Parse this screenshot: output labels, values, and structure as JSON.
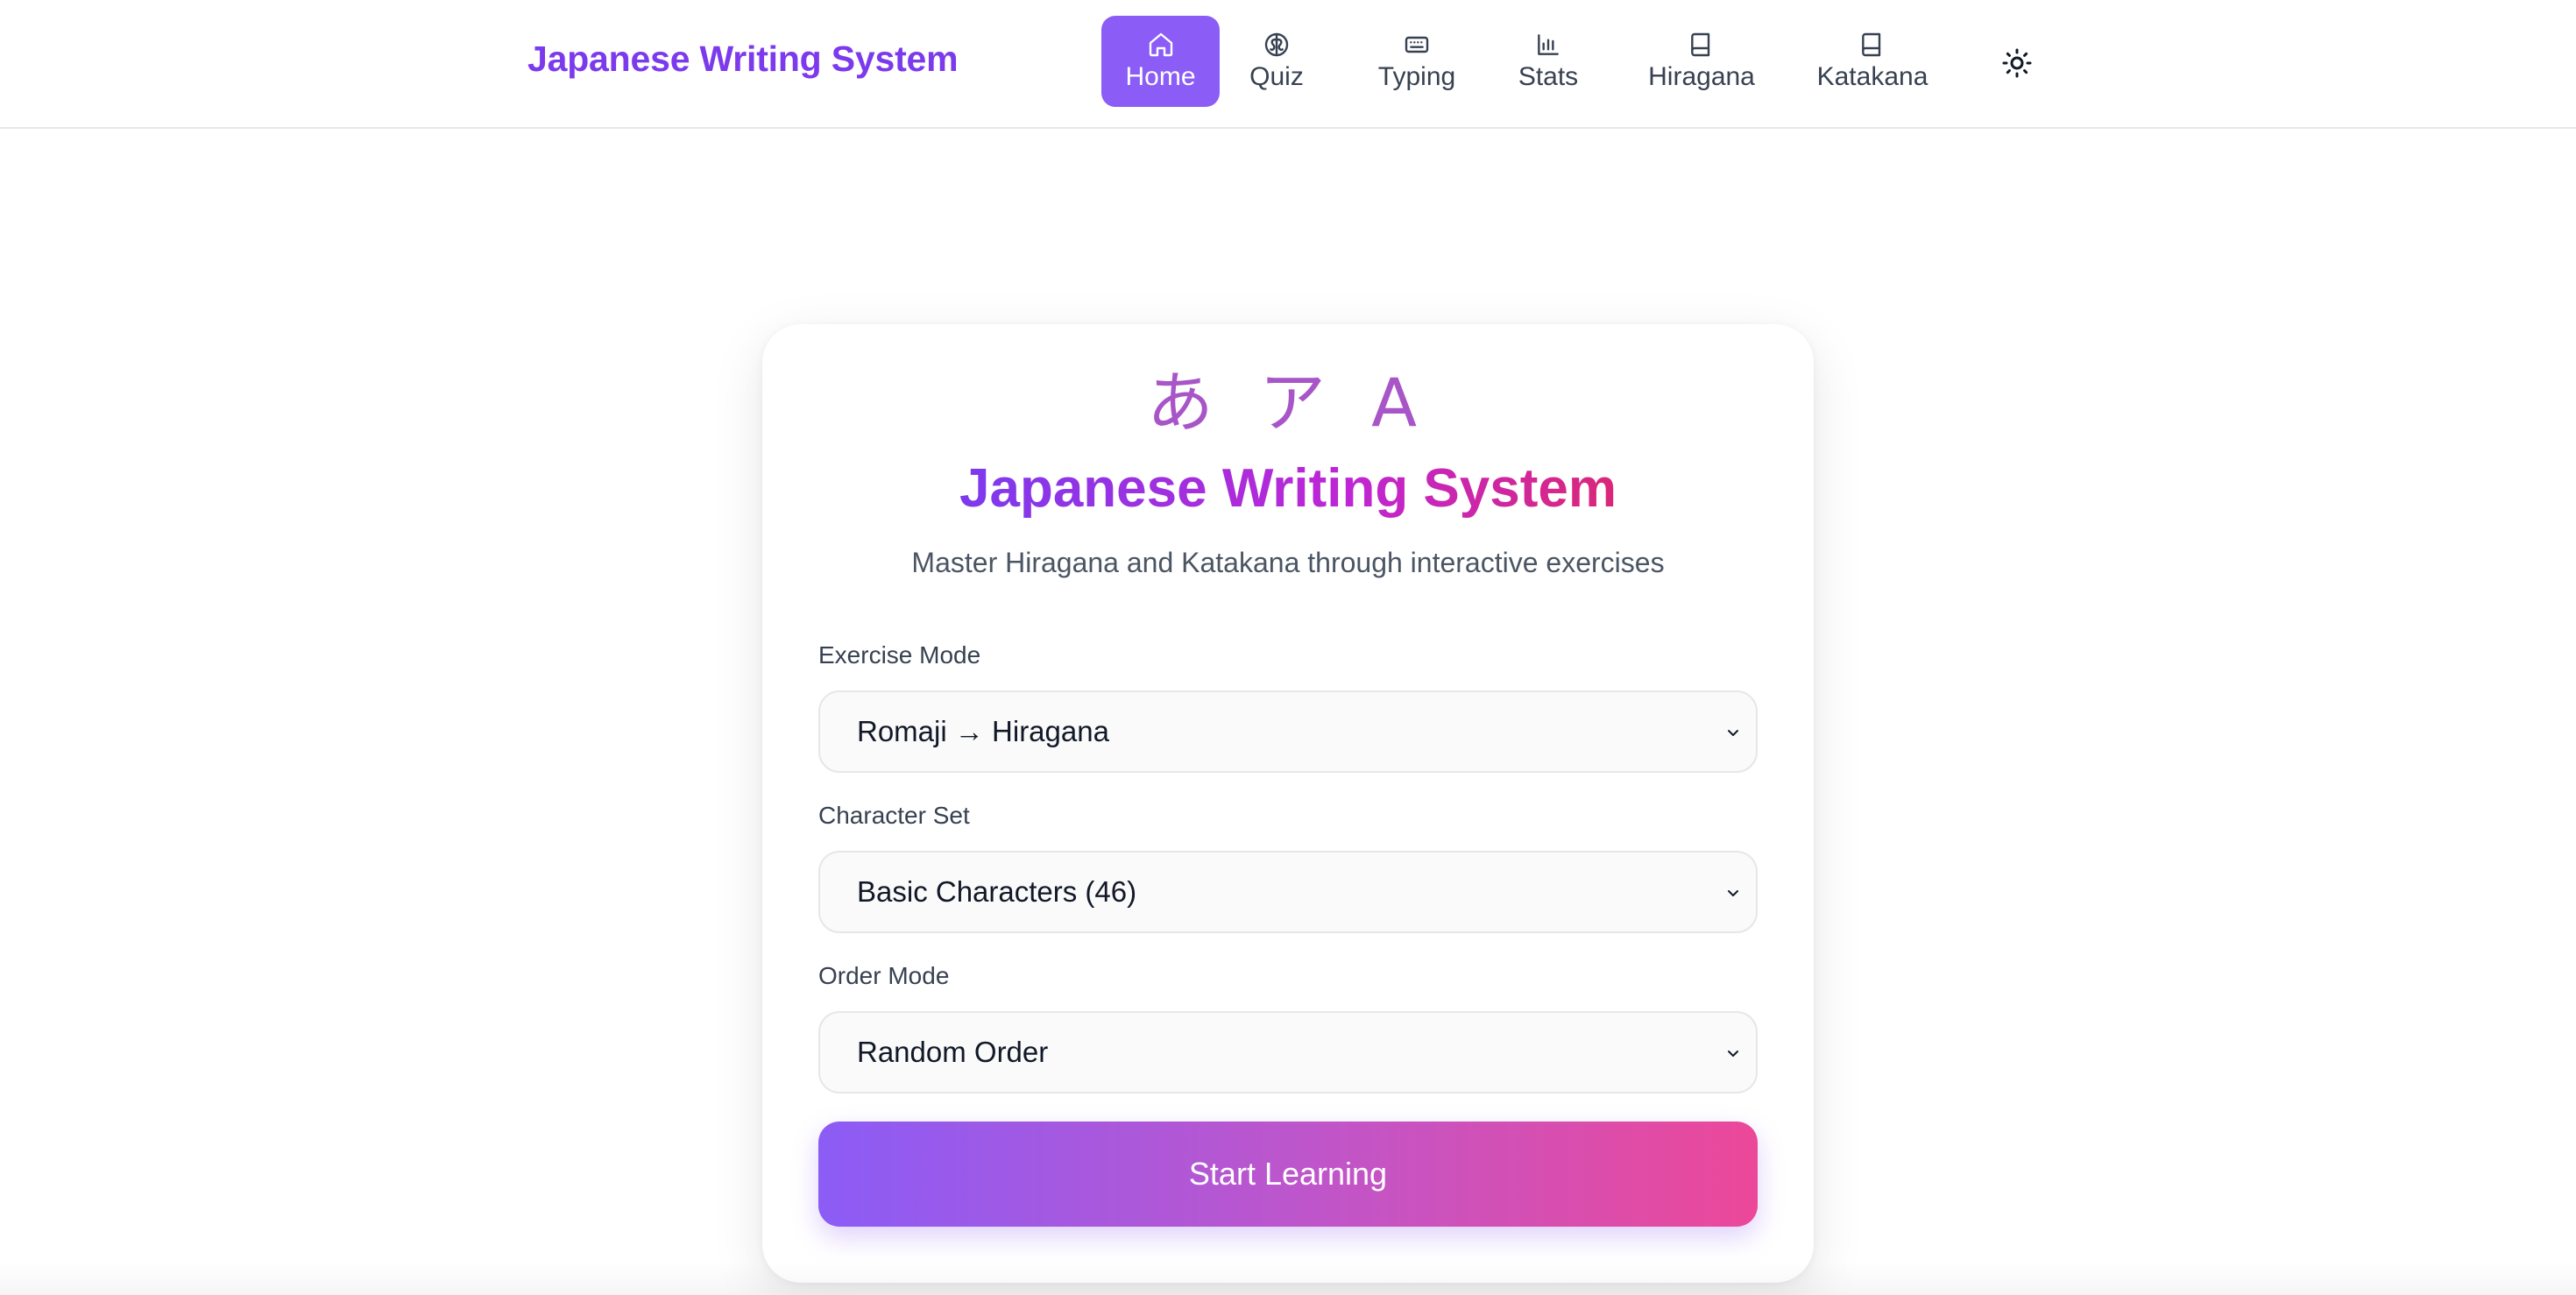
{
  "header": {
    "brand": "Japanese Writing System",
    "nav": [
      {
        "label": "Home",
        "icon": "home-icon",
        "active": true
      },
      {
        "label": "Quiz",
        "icon": "brain-icon",
        "active": false
      },
      {
        "label": "Typing",
        "icon": "keyboard-icon",
        "active": false
      },
      {
        "label": "Stats",
        "icon": "bar-chart-icon",
        "active": false
      },
      {
        "label": "Hiragana",
        "icon": "book-icon",
        "active": false
      },
      {
        "label": "Katakana",
        "icon": "book-icon",
        "active": false
      }
    ],
    "theme_toggle_icon": "sun-icon"
  },
  "card": {
    "glyphs": "あ ア A",
    "title": "Japanese Writing System",
    "subtitle": "Master Hiragana and Katakana through interactive exercises",
    "fields": [
      {
        "label": "Exercise Mode",
        "value": "Romaji → Hiragana"
      },
      {
        "label": "Character Set",
        "value": "Basic Characters (46)"
      },
      {
        "label": "Order Mode",
        "value": "Random Order"
      }
    ],
    "start_button": "Start Learning"
  },
  "colors": {
    "brand": "#7c3aed",
    "nav_active": "#8b5cf6",
    "gradient_start": "#8b5cf6",
    "gradient_end": "#ec4899"
  }
}
